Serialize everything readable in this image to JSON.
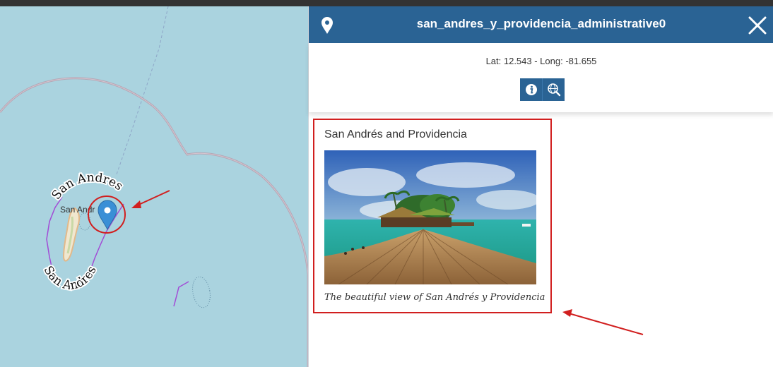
{
  "panel": {
    "title": "san_andres_y_providencia_administrative0",
    "coordinates": "Lat: 12.543 - Long: -81.655",
    "close_icon": "close-icon",
    "header_icon": "map-marker-icon",
    "buttons": [
      {
        "icon": "info-icon"
      },
      {
        "icon": "globe-search-icon"
      }
    ],
    "header_color": "#2a6394"
  },
  "card": {
    "title": "San Andrés and Providencia",
    "caption": "The beautiful view of San Andrés y Providencia",
    "image": "panoramic-island-pier-photo"
  },
  "map": {
    "labels": {
      "place": "San Andr",
      "curved_top": "San Andres",
      "curved_bottom": "San Andres"
    },
    "marker_color": "#3a8fd6",
    "sea_color": "#aad3df"
  },
  "annotations": {
    "color": "#d11f1f"
  }
}
